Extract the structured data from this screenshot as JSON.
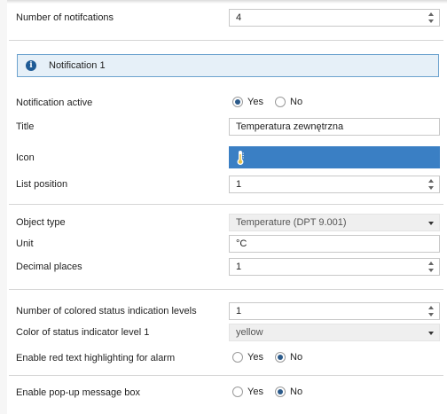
{
  "num_notifications": {
    "label": "Number of notifcations",
    "value": "4"
  },
  "notification": {
    "title": "Notification 1"
  },
  "active": {
    "label": "Notification active",
    "options": [
      "Yes",
      "No"
    ],
    "selected": "Yes"
  },
  "title_field": {
    "label": "Title",
    "value": "Temperatura zewnętrzna"
  },
  "icon_field": {
    "label": "Icon",
    "icon": "thermometer-icon",
    "bg_color": "#3a7fc4"
  },
  "list_position": {
    "label": "List position",
    "value": "1"
  },
  "object_type": {
    "label": "Object type",
    "value": "Temperature (DPT 9.001)"
  },
  "unit": {
    "label": "Unit",
    "value": "°C"
  },
  "decimal_places": {
    "label": "Decimal places",
    "value": "1"
  },
  "status_levels": {
    "label": "Number of colored status indication levels",
    "value": "1"
  },
  "status_color": {
    "label": "Color of status indicator level 1",
    "value": "yellow"
  },
  "red_text": {
    "label": "Enable red text highlighting for alarm",
    "options": [
      "Yes",
      "No"
    ],
    "selected": "No"
  },
  "popup": {
    "label": "Enable pop-up message box",
    "options": [
      "Yes",
      "No"
    ],
    "selected": "No"
  }
}
